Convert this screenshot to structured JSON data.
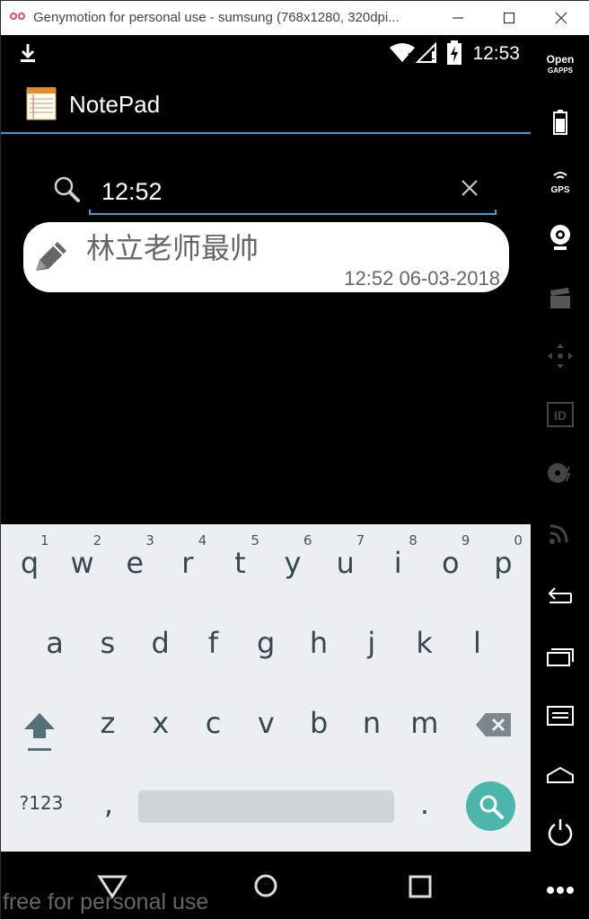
{
  "window": {
    "title": "Genymotion for personal use - sumsung (768x1280, 320dpi...",
    "minimize_icon": "minimize-icon",
    "maximize_icon": "maximize-icon",
    "close_icon": "close-icon"
  },
  "status_bar": {
    "time": "12:53",
    "icons": [
      "download-icon",
      "wifi-icon",
      "signal-icon",
      "battery-charging-icon"
    ]
  },
  "action_bar": {
    "app_icon": "notepad-icon",
    "title": "NotePad"
  },
  "search": {
    "value": "12:52",
    "search_icon": "search-icon",
    "clear_icon": "clear-icon"
  },
  "notes": [
    {
      "title": "林立老师最帅",
      "date": "12:52 06-03-2018",
      "icon": "pencil-icon"
    }
  ],
  "keyboard": {
    "row1": [
      "q",
      "w",
      "e",
      "r",
      "t",
      "y",
      "u",
      "i",
      "o",
      "p"
    ],
    "row1_hints": [
      "1",
      "2",
      "3",
      "4",
      "5",
      "6",
      "7",
      "8",
      "9",
      "0"
    ],
    "row2": [
      "a",
      "s",
      "d",
      "f",
      "g",
      "h",
      "j",
      "k",
      "l"
    ],
    "row3": [
      "z",
      "x",
      "c",
      "v",
      "b",
      "n",
      "m"
    ],
    "symbols_label": "?123",
    "comma": ",",
    "period": ".",
    "shift_icon": "shift-icon",
    "backspace_icon": "backspace-icon",
    "search_action_icon": "search-icon",
    "accent_color": "#4db6ac"
  },
  "nav_bar": {
    "icons": [
      "back-icon",
      "home-icon",
      "recents-icon"
    ]
  },
  "watermark": "free for personal use",
  "sidebar": {
    "open_gapps": "Open\nGAPPS",
    "gps": "GPS",
    "id": "ID",
    "icons": [
      "open-gapps-icon",
      "battery-icon",
      "gps-icon",
      "webcam-icon",
      "media-icon",
      "dpad-icon",
      "device-id-icon",
      "disk-icon",
      "cast-icon",
      "back-icon",
      "recent-apps-icon",
      "menu-icon",
      "home-icon",
      "power-icon",
      "more-icon"
    ]
  }
}
